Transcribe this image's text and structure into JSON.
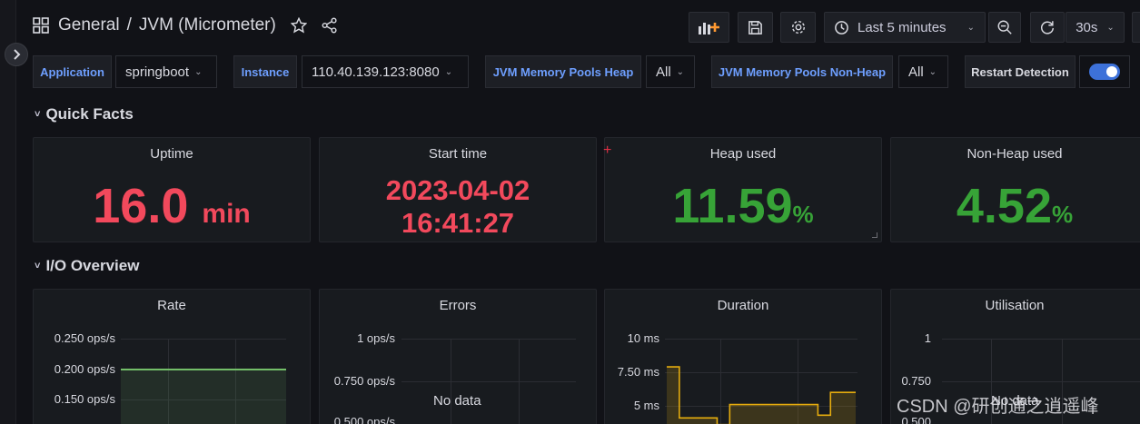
{
  "header": {
    "folder": "General",
    "separator": "/",
    "title": "JVM (Micrometer)",
    "time_range": "Last 5 minutes",
    "refresh_interval": "30s"
  },
  "variables": {
    "application": {
      "label": "Application",
      "value": "springboot"
    },
    "instance": {
      "label": "Instance",
      "value": "110.40.139.123:8080"
    },
    "heap_pools": {
      "label": "JVM Memory Pools Heap",
      "value": "All"
    },
    "nonheap_pools": {
      "label": "JVM Memory Pools Non-Heap",
      "value": "All"
    },
    "restart": {
      "label": "Restart Detection",
      "enabled": true
    }
  },
  "rows": {
    "quick_facts": "Quick Facts",
    "io_overview": "I/O Overview"
  },
  "quick_facts": {
    "uptime": {
      "title": "Uptime",
      "value": "16.0",
      "unit": "min",
      "color": "#f2495c"
    },
    "start_time": {
      "title": "Start time",
      "date": "2023-04-02",
      "time": "16:41:27",
      "color": "#f2495c"
    },
    "heap_used": {
      "title": "Heap used",
      "value": "11.59",
      "unit": "%",
      "color": "#37a337"
    },
    "nonheap_used": {
      "title": "Non-Heap used",
      "value": "4.52",
      "unit": "%",
      "color": "#37a337"
    }
  },
  "io_panels": {
    "rate": {
      "title": "Rate",
      "ticks": [
        "0.250 ops/s",
        "0.200 ops/s",
        "0.150 ops/s"
      ],
      "series_value": 0.2,
      "series_color": "#73bf69"
    },
    "errors": {
      "title": "Errors",
      "ticks": [
        "1 ops/s",
        "0.750 ops/s",
        "0.500 ops/s"
      ],
      "no_data": "No data"
    },
    "duration": {
      "title": "Duration",
      "ticks": [
        "10 ms",
        "7.50 ms",
        "5 ms"
      ],
      "series_color": "#e5ac0e",
      "series_values_ms": [
        7.9,
        4.1,
        4.1,
        4.1,
        3.6,
        5.1,
        5.1,
        5.1,
        5.1,
        5.1,
        5.1,
        5.1,
        4.3,
        6.0,
        6.0,
        6.0
      ]
    },
    "utilisation": {
      "title": "Utilisation",
      "ticks": [
        "1",
        "0.750",
        "0.500"
      ],
      "no_data": "No data"
    }
  },
  "watermark": "CSDN @研创通之逍遥峰",
  "colors": {
    "accent": "#6e9fff",
    "panel_bg": "#181b1f",
    "page_bg": "#111217"
  }
}
